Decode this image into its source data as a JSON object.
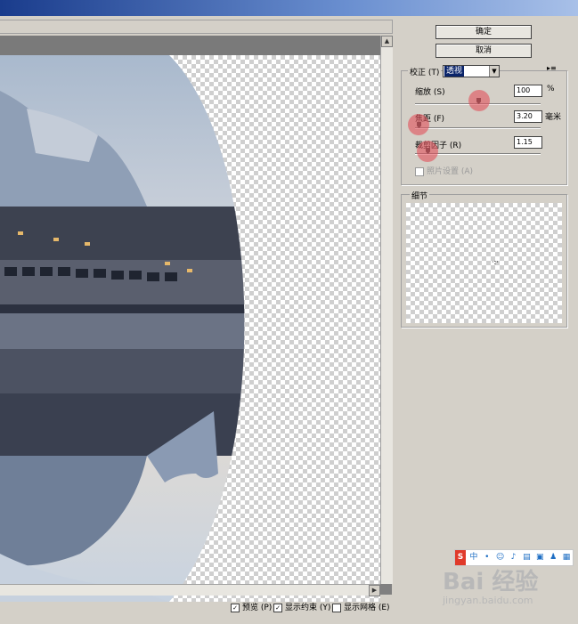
{
  "buttons": {
    "ok": "确定",
    "cancel": "取消"
  },
  "correction": {
    "group_label": "校正 (T)",
    "mode": "透视",
    "zoom_label": "缩放 (S)",
    "zoom_value": "100",
    "zoom_unit": "%",
    "focal_label": "焦距 (F)",
    "focal_value": "3.20",
    "focal_unit": "毫米",
    "crop_label": "裁剪因子 (R)",
    "crop_value": "1.15",
    "as_shot_label": "照片设置 (A)"
  },
  "detail": {
    "label": "细节"
  },
  "footer": {
    "preview": "预览 (P)",
    "show_constraints": "显示约束 (Y)",
    "show_grid": "显示网格 (E)"
  },
  "ime": {
    "logo": "S",
    "text": "中"
  },
  "watermark": {
    "brand": "Bai 经验",
    "url": "jingyan.baidu.com"
  }
}
